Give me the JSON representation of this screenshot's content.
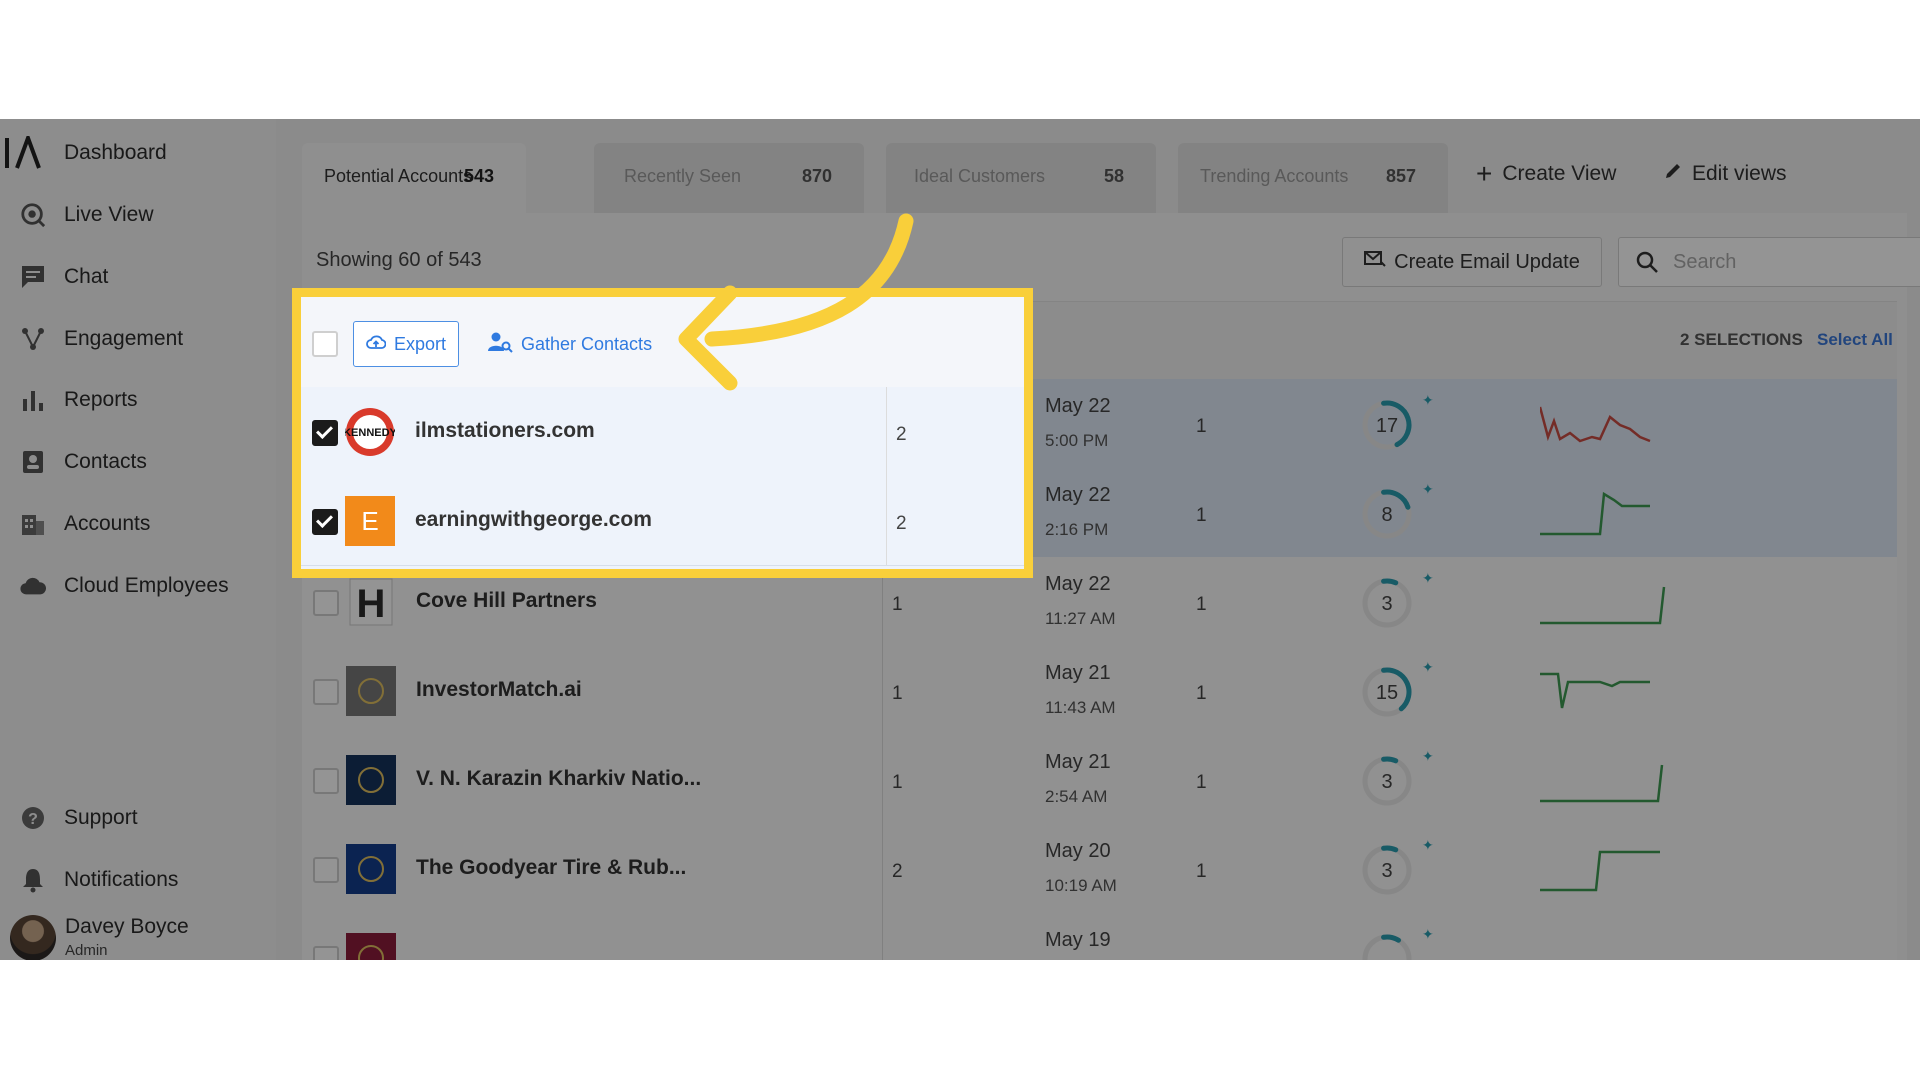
{
  "sidebar": {
    "items": [
      {
        "label": "Dashboard",
        "icon": "logo-mark"
      },
      {
        "label": "Live View",
        "icon": "live-view-icon"
      },
      {
        "label": "Chat",
        "icon": "chat-icon"
      },
      {
        "label": "Engagement",
        "icon": "engagement-icon"
      },
      {
        "label": "Reports",
        "icon": "bar-chart-icon"
      },
      {
        "label": "Contacts",
        "icon": "contacts-icon"
      },
      {
        "label": "Accounts",
        "icon": "building-icon"
      },
      {
        "label": "Cloud Employees",
        "icon": "cloud-icon"
      }
    ],
    "bottom": [
      {
        "label": "Support",
        "icon": "help-icon"
      },
      {
        "label": "Notifications",
        "icon": "bell-icon"
      }
    ],
    "user": {
      "name": "Davey Boyce",
      "role": "Admin"
    }
  },
  "tabs": [
    {
      "label": "Potential Accounts",
      "count": "543"
    },
    {
      "label": "Recently Seen",
      "count": "870"
    },
    {
      "label": "Ideal Customers",
      "count": "58"
    },
    {
      "label": "Trending Accounts",
      "count": "857"
    }
  ],
  "actions": {
    "create_view": "Create View",
    "edit_views": "Edit views"
  },
  "toolbar": {
    "showing": "Showing 60 of  543",
    "create_email": "Create Email Update",
    "search_placeholder": "Search"
  },
  "selection": {
    "export": "Export",
    "gather": "Gather Contacts",
    "count_label": "2 SELECTIONS",
    "select_all": "Select All"
  },
  "rows": [
    {
      "name": "ilmstationers.com",
      "num": "2",
      "date": "May 22",
      "time": "5:00 PM",
      "visits": "1",
      "score": "17",
      "score_frac": 0.6,
      "checked": true,
      "logo_text": "KENNEDY",
      "logo_color": "#d93a2b",
      "spark_color": "#c84d44"
    },
    {
      "name": "earningwithgeorge.com",
      "num": "2",
      "date": "May 22",
      "time": "2:16 PM",
      "visits": "1",
      "score": "8",
      "score_frac": 0.3,
      "checked": true,
      "logo_text": "E",
      "logo_color": "#f28a1a",
      "spark_color": "#3d9a52"
    },
    {
      "name": "Cove Hill Partners",
      "num": "1",
      "date": "May 22",
      "time": "11:27 AM",
      "visits": "1",
      "score": "3",
      "score_frac": 0.12,
      "checked": false,
      "logo_text": "H",
      "logo_color": "#2c2c2c",
      "spark_color": "#3d9a52"
    },
    {
      "name": "InvestorMatch.ai",
      "num": "1",
      "date": "May 21",
      "time": "11:43 AM",
      "visits": "1",
      "score": "15",
      "score_frac": 0.55,
      "checked": false,
      "logo_text": "",
      "logo_color": "#777777",
      "spark_color": "#3d9a52"
    },
    {
      "name": "V. N. Karazin Kharkiv Natio...",
      "num": "1",
      "date": "May 21",
      "time": "2:54 AM",
      "visits": "1",
      "score": "3",
      "score_frac": 0.12,
      "checked": false,
      "logo_text": "",
      "logo_color": "#16325c",
      "spark_color": "#3d9a52"
    },
    {
      "name": "The Goodyear Tire & Rub...",
      "num": "2",
      "date": "May 20",
      "time": "10:19 AM",
      "visits": "1",
      "score": "3",
      "score_frac": 0.12,
      "checked": false,
      "logo_text": "",
      "logo_color": "#143d8c",
      "spark_color": "#3d9a52"
    },
    {
      "name": "",
      "num": "",
      "date": "May 19",
      "time": "",
      "visits": "",
      "score": "",
      "score_frac": 0.15,
      "checked": false,
      "logo_text": "",
      "logo_color": "#8c1d3b",
      "spark_color": "#3d9a52"
    }
  ],
  "colors": {
    "highlight": "#f9cf3a",
    "accent": "#2f7ae0",
    "gauge": "#2a9db0"
  }
}
